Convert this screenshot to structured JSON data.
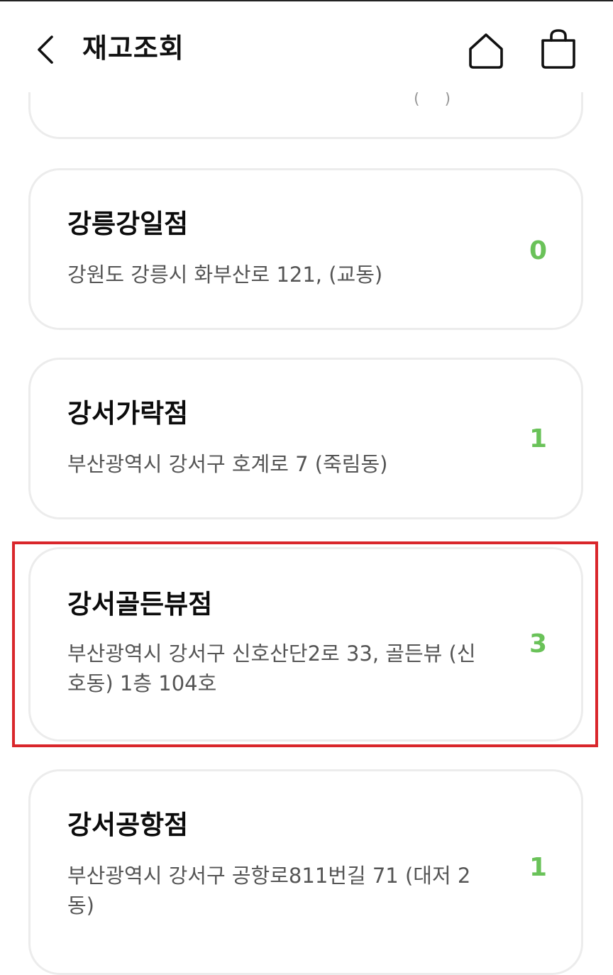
{
  "header": {
    "title": "재고조회",
    "icons": {
      "back": "chevron-left-icon",
      "home": "home-icon",
      "bag": "shopping-bag-icon"
    }
  },
  "stores": [
    {
      "name": "강릉강일점",
      "address": "강원도 강릉시 화부산로 121, (교동)",
      "stock": "0"
    },
    {
      "name": "강서가락점",
      "address": "부산광역시 강서구 호계로 7 (죽림동)",
      "stock": "1"
    },
    {
      "name": "강서골든뷰점",
      "address": "부산광역시 강서구 신호산단2로 33, 골든뷰 (신호동) 1층 104호",
      "stock": "3"
    },
    {
      "name": "강서공항점",
      "address": "부산광역시 강서구 공항로811번길 71 (대저 2동)",
      "stock": "1"
    }
  ],
  "colors": {
    "stock": "#6ac259",
    "highlight": "#d9262b",
    "card_border": "#ececec"
  }
}
